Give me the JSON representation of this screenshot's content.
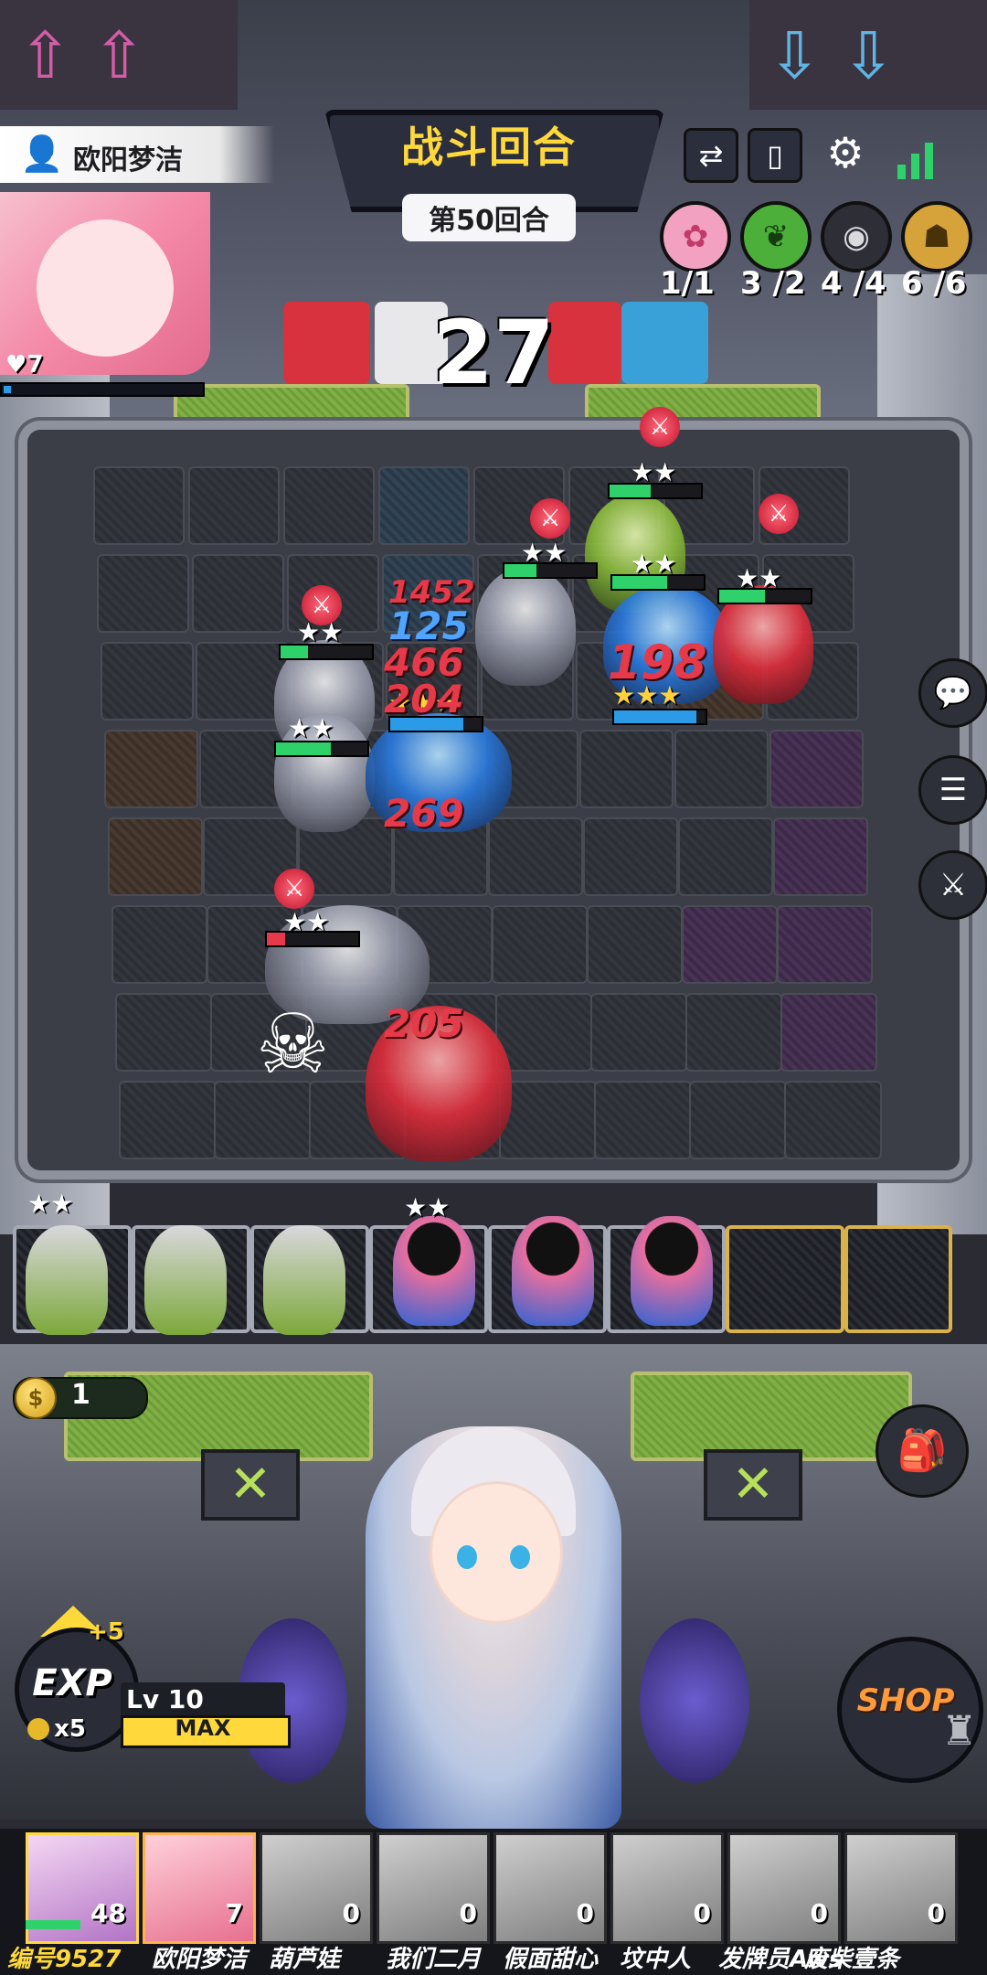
{
  "colors": {
    "accent_yellow": "#ffd93b",
    "damage_red": "#e63a4a",
    "heal_green": "#2fd16a",
    "board_dark": "#2c2e35",
    "synergy_pink": "#f2a2c0",
    "synergy_green": "#4caf3a",
    "synergy_grey": "#2e2f36",
    "synergy_gold": "#d6a23a"
  },
  "player": {
    "name": "欧阳梦洁",
    "hp": "7",
    "hp_fraction": 0.04
  },
  "round": {
    "title": "战斗回合",
    "subtitle": "第50回合",
    "timer": "27"
  },
  "top_icons": [
    "phone-swap-icon",
    "book-icon",
    "gear-icon",
    "signal-icon"
  ],
  "synergies": [
    {
      "icon": "sakura-icon",
      "count": "1/1"
    },
    {
      "icon": "leaf-icon",
      "count": "3 /2"
    },
    {
      "icon": "eye-icon",
      "count": "4 /4"
    },
    {
      "icon": "hood-icon",
      "count": "6 /6"
    }
  ],
  "damage_numbers": [
    "1452",
    "125",
    "466",
    "204",
    "198",
    "269",
    "205"
  ],
  "side_buttons": [
    "chat-icon",
    "player-list-icon",
    "sword-list-icon"
  ],
  "gold": {
    "amount": "1"
  },
  "exp": {
    "label": "EXP",
    "plus": "+5",
    "cost": "x5"
  },
  "level": {
    "label": "Lv 10",
    "max": "MAX"
  },
  "shop": {
    "label": "SHOP"
  },
  "players": [
    {
      "name": "编号9527",
      "hp": "48"
    },
    {
      "name": "欧阳梦洁",
      "hp": "7"
    },
    {
      "name": "葫芦娃",
      "hp": "0"
    },
    {
      "name": "我们二月",
      "hp": "0"
    },
    {
      "name": "假面甜心",
      "hp": "0"
    },
    {
      "name": "坟中人",
      "hp": "0"
    },
    {
      "name": "发牌员Aws",
      "hp": "0"
    },
    {
      "name": "废柴壹条",
      "hp": "0"
    }
  ]
}
